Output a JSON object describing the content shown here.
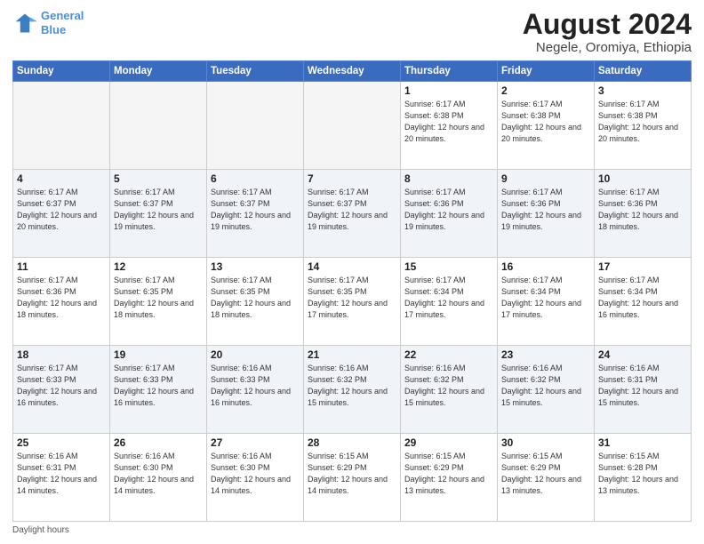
{
  "logo": {
    "line1": "General",
    "line2": "Blue"
  },
  "title": "August 2024",
  "subtitle": "Negele, Oromiya, Ethiopia",
  "days_of_week": [
    "Sunday",
    "Monday",
    "Tuesday",
    "Wednesday",
    "Thursday",
    "Friday",
    "Saturday"
  ],
  "footer": "Daylight hours",
  "weeks": [
    [
      {
        "day": "",
        "info": "",
        "empty": true
      },
      {
        "day": "",
        "info": "",
        "empty": true
      },
      {
        "day": "",
        "info": "",
        "empty": true
      },
      {
        "day": "",
        "info": "",
        "empty": true
      },
      {
        "day": "1",
        "info": "Sunrise: 6:17 AM\nSunset: 6:38 PM\nDaylight: 12 hours\nand 20 minutes.",
        "empty": false
      },
      {
        "day": "2",
        "info": "Sunrise: 6:17 AM\nSunset: 6:38 PM\nDaylight: 12 hours\nand 20 minutes.",
        "empty": false
      },
      {
        "day": "3",
        "info": "Sunrise: 6:17 AM\nSunset: 6:38 PM\nDaylight: 12 hours\nand 20 minutes.",
        "empty": false
      }
    ],
    [
      {
        "day": "4",
        "info": "Sunrise: 6:17 AM\nSunset: 6:37 PM\nDaylight: 12 hours\nand 20 minutes.",
        "empty": false
      },
      {
        "day": "5",
        "info": "Sunrise: 6:17 AM\nSunset: 6:37 PM\nDaylight: 12 hours\nand 19 minutes.",
        "empty": false
      },
      {
        "day": "6",
        "info": "Sunrise: 6:17 AM\nSunset: 6:37 PM\nDaylight: 12 hours\nand 19 minutes.",
        "empty": false
      },
      {
        "day": "7",
        "info": "Sunrise: 6:17 AM\nSunset: 6:37 PM\nDaylight: 12 hours\nand 19 minutes.",
        "empty": false
      },
      {
        "day": "8",
        "info": "Sunrise: 6:17 AM\nSunset: 6:36 PM\nDaylight: 12 hours\nand 19 minutes.",
        "empty": false
      },
      {
        "day": "9",
        "info": "Sunrise: 6:17 AM\nSunset: 6:36 PM\nDaylight: 12 hours\nand 19 minutes.",
        "empty": false
      },
      {
        "day": "10",
        "info": "Sunrise: 6:17 AM\nSunset: 6:36 PM\nDaylight: 12 hours\nand 18 minutes.",
        "empty": false
      }
    ],
    [
      {
        "day": "11",
        "info": "Sunrise: 6:17 AM\nSunset: 6:36 PM\nDaylight: 12 hours\nand 18 minutes.",
        "empty": false
      },
      {
        "day": "12",
        "info": "Sunrise: 6:17 AM\nSunset: 6:35 PM\nDaylight: 12 hours\nand 18 minutes.",
        "empty": false
      },
      {
        "day": "13",
        "info": "Sunrise: 6:17 AM\nSunset: 6:35 PM\nDaylight: 12 hours\nand 18 minutes.",
        "empty": false
      },
      {
        "day": "14",
        "info": "Sunrise: 6:17 AM\nSunset: 6:35 PM\nDaylight: 12 hours\nand 17 minutes.",
        "empty": false
      },
      {
        "day": "15",
        "info": "Sunrise: 6:17 AM\nSunset: 6:34 PM\nDaylight: 12 hours\nand 17 minutes.",
        "empty": false
      },
      {
        "day": "16",
        "info": "Sunrise: 6:17 AM\nSunset: 6:34 PM\nDaylight: 12 hours\nand 17 minutes.",
        "empty": false
      },
      {
        "day": "17",
        "info": "Sunrise: 6:17 AM\nSunset: 6:34 PM\nDaylight: 12 hours\nand 16 minutes.",
        "empty": false
      }
    ],
    [
      {
        "day": "18",
        "info": "Sunrise: 6:17 AM\nSunset: 6:33 PM\nDaylight: 12 hours\nand 16 minutes.",
        "empty": false
      },
      {
        "day": "19",
        "info": "Sunrise: 6:17 AM\nSunset: 6:33 PM\nDaylight: 12 hours\nand 16 minutes.",
        "empty": false
      },
      {
        "day": "20",
        "info": "Sunrise: 6:16 AM\nSunset: 6:33 PM\nDaylight: 12 hours\nand 16 minutes.",
        "empty": false
      },
      {
        "day": "21",
        "info": "Sunrise: 6:16 AM\nSunset: 6:32 PM\nDaylight: 12 hours\nand 15 minutes.",
        "empty": false
      },
      {
        "day": "22",
        "info": "Sunrise: 6:16 AM\nSunset: 6:32 PM\nDaylight: 12 hours\nand 15 minutes.",
        "empty": false
      },
      {
        "day": "23",
        "info": "Sunrise: 6:16 AM\nSunset: 6:32 PM\nDaylight: 12 hours\nand 15 minutes.",
        "empty": false
      },
      {
        "day": "24",
        "info": "Sunrise: 6:16 AM\nSunset: 6:31 PM\nDaylight: 12 hours\nand 15 minutes.",
        "empty": false
      }
    ],
    [
      {
        "day": "25",
        "info": "Sunrise: 6:16 AM\nSunset: 6:31 PM\nDaylight: 12 hours\nand 14 minutes.",
        "empty": false
      },
      {
        "day": "26",
        "info": "Sunrise: 6:16 AM\nSunset: 6:30 PM\nDaylight: 12 hours\nand 14 minutes.",
        "empty": false
      },
      {
        "day": "27",
        "info": "Sunrise: 6:16 AM\nSunset: 6:30 PM\nDaylight: 12 hours\nand 14 minutes.",
        "empty": false
      },
      {
        "day": "28",
        "info": "Sunrise: 6:15 AM\nSunset: 6:29 PM\nDaylight: 12 hours\nand 14 minutes.",
        "empty": false
      },
      {
        "day": "29",
        "info": "Sunrise: 6:15 AM\nSunset: 6:29 PM\nDaylight: 12 hours\nand 13 minutes.",
        "empty": false
      },
      {
        "day": "30",
        "info": "Sunrise: 6:15 AM\nSunset: 6:29 PM\nDaylight: 12 hours\nand 13 minutes.",
        "empty": false
      },
      {
        "day": "31",
        "info": "Sunrise: 6:15 AM\nSunset: 6:28 PM\nDaylight: 12 hours\nand 13 minutes.",
        "empty": false
      }
    ]
  ]
}
